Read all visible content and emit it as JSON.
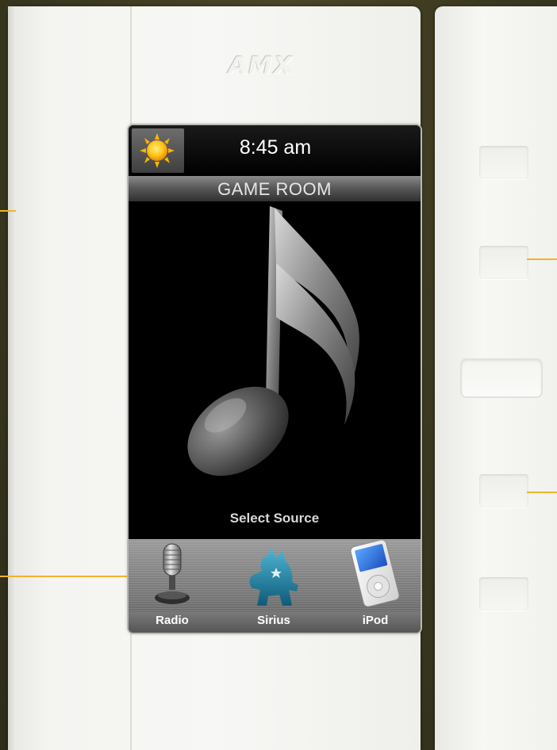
{
  "brand": {
    "logo_text": "AMX"
  },
  "status_bar": {
    "weather_icon": "sun-icon",
    "time": "8:45 am"
  },
  "room": {
    "name": "GAME ROOM"
  },
  "main": {
    "icon": "music-note-icon",
    "prompt": "Select Source"
  },
  "sources": [
    {
      "label": "Radio",
      "icon": "microphone-icon"
    },
    {
      "label": "Sirius",
      "icon": "sirius-dog-icon"
    },
    {
      "label": "iPod",
      "icon": "ipod-icon"
    }
  ],
  "colors": {
    "callout": "#f1b32b",
    "screen_bg": "#000000",
    "panel": "#f4f4f1",
    "background": "#3d3a22"
  }
}
